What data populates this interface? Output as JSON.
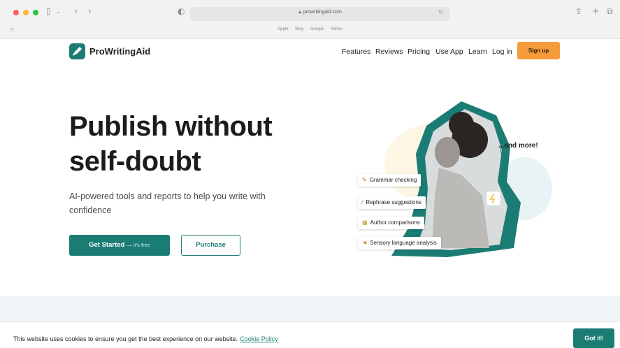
{
  "browser": {
    "url": "prowritingaid.com",
    "favorites": [
      "Apple",
      "Bing",
      "Google",
      "Yahoo"
    ],
    "colors": {
      "chrome_bg": "#f3f2f3"
    }
  },
  "site": {
    "logo_text": "ProWritingAid",
    "nav": [
      "Features",
      "Reviews",
      "Pricing",
      "Use App",
      "Learn",
      "Log in"
    ],
    "signup_label": "Sign up",
    "colors": {
      "brand": "#1b7c74",
      "accent": "#f59b3a"
    }
  },
  "hero": {
    "title_line1": "Publish without",
    "title_line2": "self-doubt",
    "subtitle": "AI-powered tools and reports to help you write with confidence",
    "start_label": "Get Started",
    "start_suffix": "— it's free",
    "purchase_label": "Purchase"
  },
  "illustration": {
    "features": [
      {
        "label": "Grammar checking",
        "icon": "pen-icon"
      },
      {
        "label": "Rephrase suggestions",
        "icon": "wand-icon"
      },
      {
        "label": "Author comparisons",
        "icon": "books-icon"
      },
      {
        "label": "Sensory language analysis",
        "icon": "hand-icon"
      }
    ],
    "more_label": "...and more!"
  },
  "cookie": {
    "text": "This website uses cookies to ensure you get the best experience on our website.",
    "link_label": "Cookie Policy",
    "button_label": "Got it!"
  }
}
